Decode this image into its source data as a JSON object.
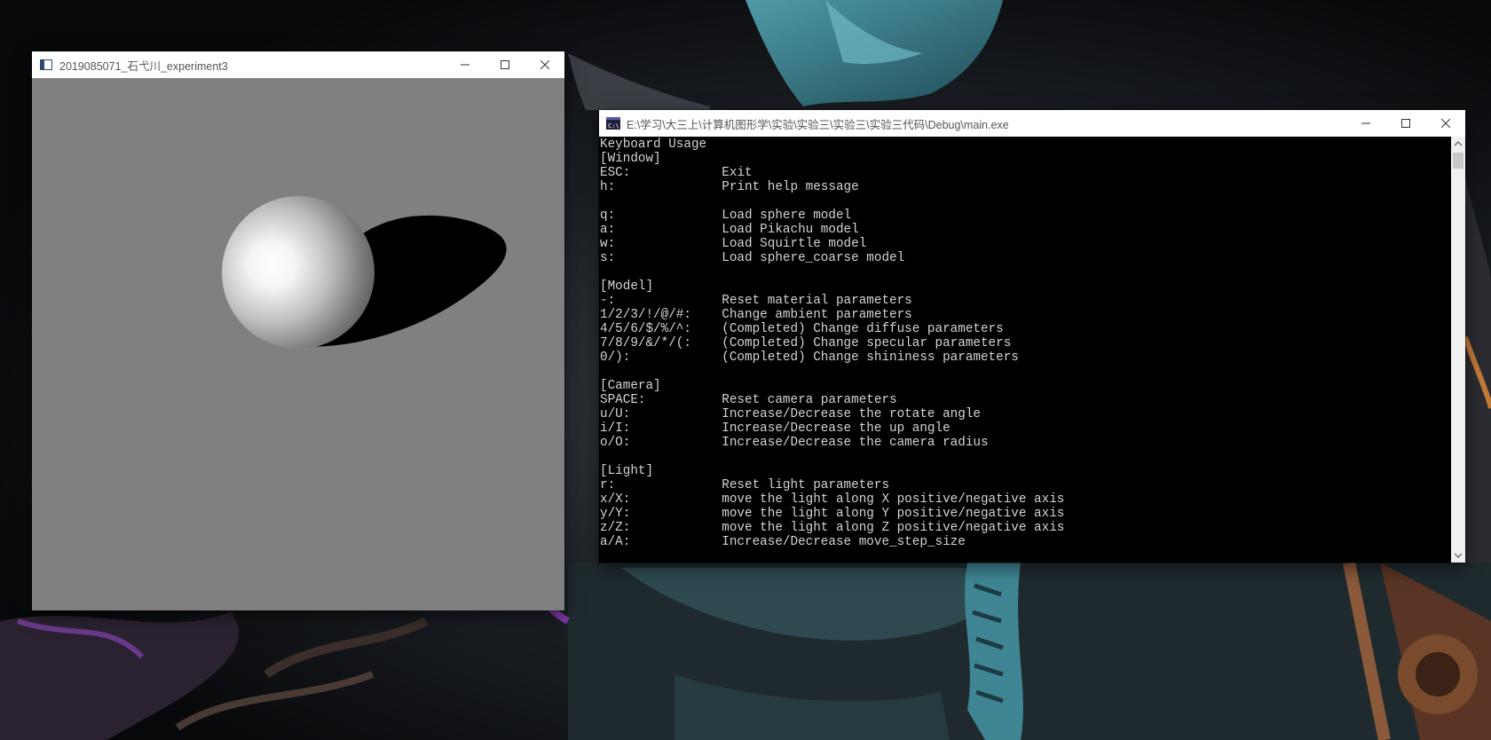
{
  "colors": {
    "gl_background": "#808080",
    "console_background": "#000000",
    "console_text": "#d4d4d4",
    "titlebar": "#ffffff",
    "title_text": "#555555"
  },
  "gl_window": {
    "title": "2019085071_石弋川_experiment3",
    "icon": "app-window-icon",
    "buttons": [
      "minimize-icon",
      "maximize-icon",
      "close-icon"
    ]
  },
  "console_window": {
    "title": "E:\\学习\\大三上\\计算机图形学\\实验\\实验三\\实验三\\实验三代码\\Debug\\main.exe",
    "icon": "console-icon",
    "icon_text": "C:\\",
    "buttons": [
      "minimize-icon",
      "maximize-icon",
      "close-icon"
    ],
    "lines": [
      "Keyboard Usage",
      "[Window]",
      "ESC:            Exit",
      "h:              Print help message",
      "",
      "q:              Load sphere model",
      "a:              Load Pikachu model",
      "w:              Load Squirtle model",
      "s:              Load sphere_coarse model",
      "",
      "[Model]",
      "-:              Reset material parameters",
      "1/2/3/!/@/#:    Change ambient parameters",
      "4/5/6/$/%/^:    (Completed) Change diffuse parameters",
      "7/8/9/&/*/(:    (Completed) Change specular parameters",
      "0/):            (Completed) Change shininess parameters",
      "",
      "[Camera]",
      "SPACE:          Reset camera parameters",
      "u/U:            Increase/Decrease the rotate angle",
      "i/I:            Increase/Decrease the up angle",
      "o/O:            Increase/Decrease the camera radius",
      "",
      "[Light]",
      "r:              Reset light parameters",
      "x/X:            move the light along X positive/negative axis",
      "y/Y:            move the light along Y positive/negative axis",
      "z/Z:            move the light along Z positive/negative axis",
      "a/A:            Increase/Decrease move_step_size"
    ]
  }
}
